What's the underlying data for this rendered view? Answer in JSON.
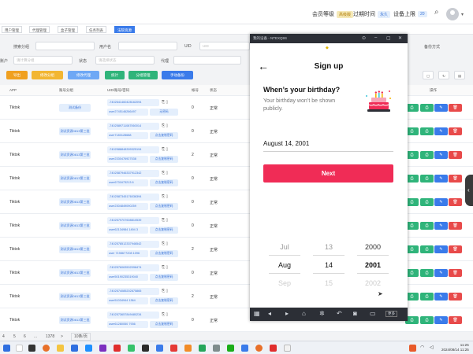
{
  "topbar": {
    "member_level_label": "会员等级",
    "member_level_badge": "高级版",
    "expire_label": "过期时间",
    "expire_badge": "永久",
    "device_limit_label": "设备上限",
    "device_limit_badge": "20"
  },
  "tabs": [
    "用户管理",
    "代理管理",
    "盒子管理",
    "任务列表",
    "法院资源"
  ],
  "filters": {
    "row1": {
      "label1": "搜索分组",
      "label2": "用户名",
      "label3": "UID",
      "label4": "备份方式",
      "uid_placeholder": "UID"
    },
    "row2": {
      "label1": "账户",
      "placeholder1": "请计算分组",
      "label2": "状态",
      "placeholder2": "请选择状态",
      "label3": "代理"
    }
  },
  "toolbar": {
    "buttons": [
      {
        "label": "导出",
        "color": "#f0a020"
      },
      {
        "label": "修改分组",
        "color": "#f2b632"
      },
      {
        "label": "修改代理",
        "color": "#6ea8f5"
      },
      {
        "label": "统计",
        "color": "#2fb47a"
      },
      {
        "label": "分组管理",
        "color": "#2fb47a"
      },
      {
        "label": "手动备份",
        "color": "#3a7bea"
      }
    ]
  },
  "table": {
    "headers": [
      "APP",
      "账号分组",
      "UID/账号/密码",
      "帐号",
      "状态",
      "操作"
    ],
    "rows": [
      {
        "app": "Tiktok",
        "group": "测试备份",
        "account": "-7402641460428162094",
        "user": "user2745146266497",
        "action": "无密码",
        "num": "0",
        "status": "正常"
      },
      {
        "app": "Tiktok",
        "group": "测试资源0813第三批",
        "account": "-7402589711087060014",
        "user": "user7183128688",
        "action": "点击复制密码",
        "num": "0",
        "status": "正常"
      },
      {
        "app": "Tiktok",
        "group": "测试资源0813第三批",
        "account": "-7402588848399325194",
        "user": "user2330476927538",
        "action": "点击复制密码",
        "num": "2",
        "status": "正常"
      },
      {
        "app": "Tiktok",
        "group": "测试资源0813第三批",
        "account": "-7402587946337912342",
        "user": "user6731673213 6",
        "action": "点击复制密码",
        "num": "0",
        "status": "正常"
      },
      {
        "app": "Tiktok",
        "group": "测试资源0813第三批",
        "account": "-7402587345176036394",
        "user": "user2304849090259",
        "action": "点击复制密码",
        "num": "0",
        "status": "正常"
      },
      {
        "app": "Tiktok",
        "group": "测试资源0813第三批",
        "account": "-7402579707608810539",
        "user": "user62134984 1494 3",
        "action": "点击复制密码",
        "num": "0",
        "status": "正常"
      },
      {
        "app": "Tiktok",
        "group": "测试资源0813第三批",
        "account": "-7402578512337946542",
        "user": "user 7198677208 1096",
        "action": "点击复制密码",
        "num": "2",
        "status": "正常"
      },
      {
        "app": "Tiktok",
        "group": "测试资源0813第三批",
        "account": "-7402576063502098474",
        "user": "user50190235319040",
        "action": "点击复制密码",
        "num": "0",
        "status": "正常"
      },
      {
        "app": "Tiktok",
        "group": "测试资源0813第三批",
        "account": "-7402574085202875865",
        "user": "user51034944 1364",
        "action": "点击复制密码",
        "num": "2",
        "status": "正常"
      },
      {
        "app": "Tiktok",
        "group": "测试资源0813第三批",
        "account": "-7402573657849480234",
        "user": "user61280050 7936",
        "action": "点击复制密码",
        "num": "0",
        "status": "正常"
      }
    ]
  },
  "pager": {
    "page4": "4",
    "page5": "5",
    "page6": "6",
    "ellipsis": "...",
    "last": "1378",
    "next": ">",
    "page_size": "10条/页"
  },
  "emulator": {
    "title": "我的设备 - NTEXQ9S",
    "screen": {
      "header": "Sign up",
      "question": "When’s your birthday?",
      "subtitle": "Your birthday won’t be shown publicly.",
      "birthday_value": "August 14, 2001",
      "next_label": "Next",
      "picker": {
        "months": [
          "Jul",
          "Aug",
          "Sep"
        ],
        "days": [
          "13",
          "14",
          "15"
        ],
        "years": [
          "2000",
          "2001",
          "2002"
        ]
      }
    },
    "nav_chip": "更多"
  },
  "taskbar": {
    "time": "11:25",
    "date": "2024/08/14 11:25"
  },
  "colors": {
    "accent_red": "#f02c56",
    "primary_blue": "#3a7bea",
    "success_green": "#2fb47a",
    "danger_red": "#e84a4a"
  }
}
